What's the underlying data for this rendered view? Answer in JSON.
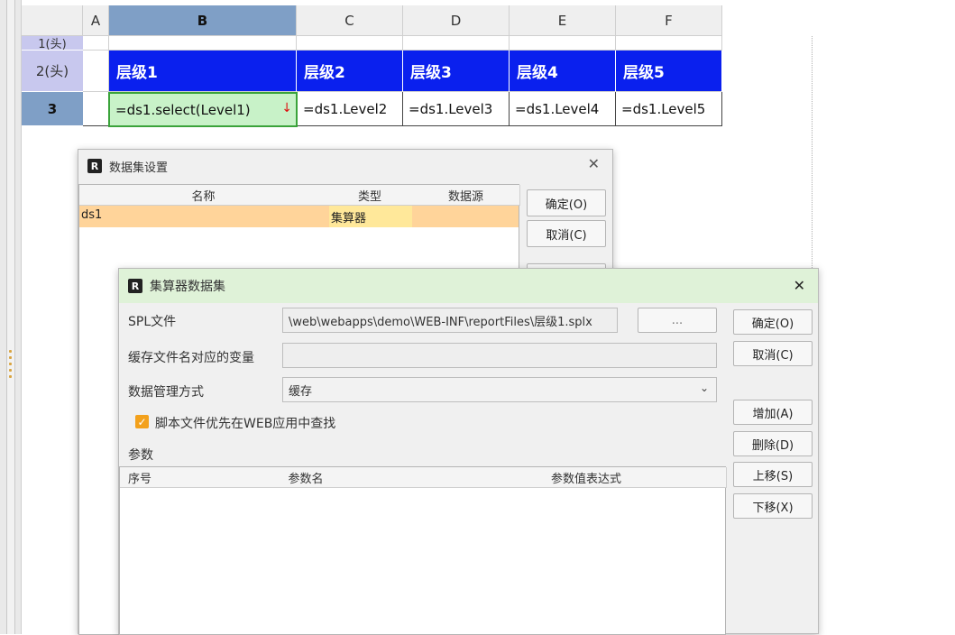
{
  "sheet": {
    "columns": [
      "A",
      "B",
      "C",
      "D",
      "E",
      "F"
    ],
    "rows": [
      {
        "label": "1(头)"
      },
      {
        "label": "2(头)"
      },
      {
        "label": "3"
      }
    ],
    "header_cells": [
      "层级1",
      "层级2",
      "层级3",
      "层级4",
      "层级5"
    ],
    "data_cells": [
      "=ds1.select(Level1)",
      "=ds1.Level2",
      "=ds1.Level3",
      "=ds1.Level4",
      "=ds1.Level5"
    ],
    "selected_cell_arrow": "↓"
  },
  "dataset_dialog": {
    "title": "数据集设置",
    "columns": [
      "名称",
      "类型",
      "数据源"
    ],
    "rows": [
      {
        "name": "ds1",
        "type": "集算器",
        "datasource": ""
      }
    ],
    "buttons": {
      "ok": "确定(O)",
      "cancel": "取消(C)"
    }
  },
  "calc_dialog": {
    "title": "集算器数据集",
    "spl_label": "SPL文件",
    "spl_value": "\\web\\webapps\\demo\\WEB-INF\\reportFiles\\层级1.splx",
    "browse_label": "...",
    "cache_var_label": "缓存文件名对应的变量",
    "cache_var_value": "",
    "mgmt_label": "数据管理方式",
    "mgmt_value": "缓存",
    "checkbox_label": "脚本文件优先在WEB应用中查找",
    "checkbox_checked": true,
    "params_label": "参数",
    "param_columns": [
      "序号",
      "参数名",
      "参数值表达式"
    ],
    "buttons": {
      "ok": "确定(O)",
      "cancel": "取消(C)",
      "add": "增加(A)",
      "delete": "删除(D)",
      "up": "上移(S)",
      "down": "下移(X)"
    }
  },
  "colors": {
    "header_blue": "#0a20ee",
    "selection_green": "#c8f2c8",
    "row_orange": "#ffd49a"
  }
}
